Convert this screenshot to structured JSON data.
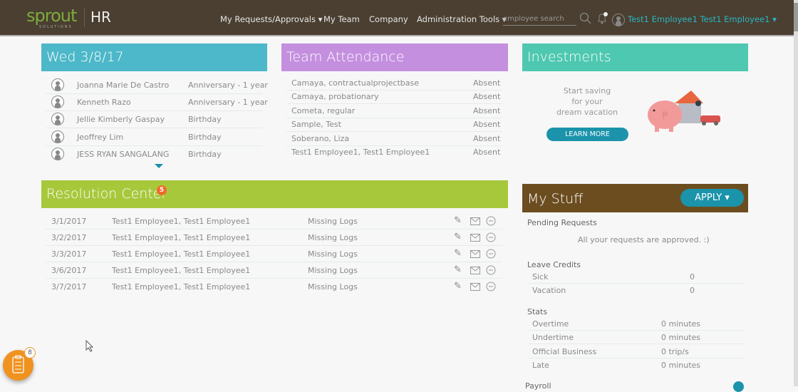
{
  "header": {
    "logo": "sprout",
    "logo_sub": "SOLUTIONS",
    "app": "HR",
    "nav": [
      "My Requests/Approvals ▾",
      "My Team",
      "Company",
      "Administration Tools ▾"
    ],
    "search_placeholder": "employee search",
    "user": "Test1 Employee1 Test1 Employee1 ▾"
  },
  "celebrations": {
    "title": "Wed 3/8/17",
    "color": "#4cb8c9",
    "items": [
      {
        "name": "Joanna Marie De Castro",
        "event": "Anniversary - 1 year"
      },
      {
        "name": "Kenneth Razo",
        "event": "Anniversary - 1 year"
      },
      {
        "name": "Jellie Kimberly Gaspay",
        "event": "Birthday"
      },
      {
        "name": "Jeoffrey Lim",
        "event": "Birthday"
      },
      {
        "name": "JESS RYAN SANGALANG",
        "event": "Birthday"
      }
    ]
  },
  "attendance": {
    "title": "Team Attendance",
    "color": "#c48fdf",
    "items": [
      {
        "name": "Camaya, contractualprojectbase",
        "status": "Absent"
      },
      {
        "name": "Camaya, probationary",
        "status": "Absent"
      },
      {
        "name": "Cometa, regular",
        "status": "Absent"
      },
      {
        "name": "Sample, Test",
        "status": "Absent"
      },
      {
        "name": "Soberano, Liza",
        "status": "Absent"
      },
      {
        "name": "Test1 Employee1, Test1 Employee1",
        "status": "Absent"
      }
    ]
  },
  "investments": {
    "title": "Investments",
    "color": "#4ec8b0",
    "text": [
      "Start saving",
      "for your",
      "dream vacation"
    ],
    "button": "LEARN MORE"
  },
  "resolution": {
    "title": "Resolution Center",
    "badge": "5",
    "color": "#a8c83c",
    "items": [
      {
        "date": "3/1/2017",
        "name": "Test1 Employee1, Test1 Employee1",
        "issue": "Missing Logs"
      },
      {
        "date": "3/2/2017",
        "name": "Test1 Employee1, Test1 Employee1",
        "issue": "Missing Logs"
      },
      {
        "date": "3/3/2017",
        "name": "Test1 Employee1, Test1 Employee1",
        "issue": "Missing Logs"
      },
      {
        "date": "3/6/2017",
        "name": "Test1 Employee1, Test1 Employee1",
        "issue": "Missing Logs"
      },
      {
        "date": "3/7/2017",
        "name": "Test1 Employee1, Test1 Employee1",
        "issue": "Missing Logs"
      }
    ]
  },
  "mystuff": {
    "title": "My Stuff",
    "color": "#6b4d20",
    "apply": "APPLY ▾",
    "pending_label": "Pending Requests",
    "pending_text": "All your requests are approved. :)",
    "leave_label": "Leave Credits",
    "leave": [
      {
        "label": "Sick",
        "value": "0"
      },
      {
        "label": "Vacation",
        "value": "0"
      }
    ],
    "stats_label": "Stats",
    "stats": [
      {
        "label": "Overtime",
        "value": "0 minutes"
      },
      {
        "label": "Undertime",
        "value": "0 minutes"
      },
      {
        "label": "Official Business",
        "value": "0 trip/s"
      },
      {
        "label": "Late",
        "value": "0 minutes"
      }
    ],
    "payroll_label": "Payroll"
  },
  "fab": {
    "badge": "8"
  }
}
